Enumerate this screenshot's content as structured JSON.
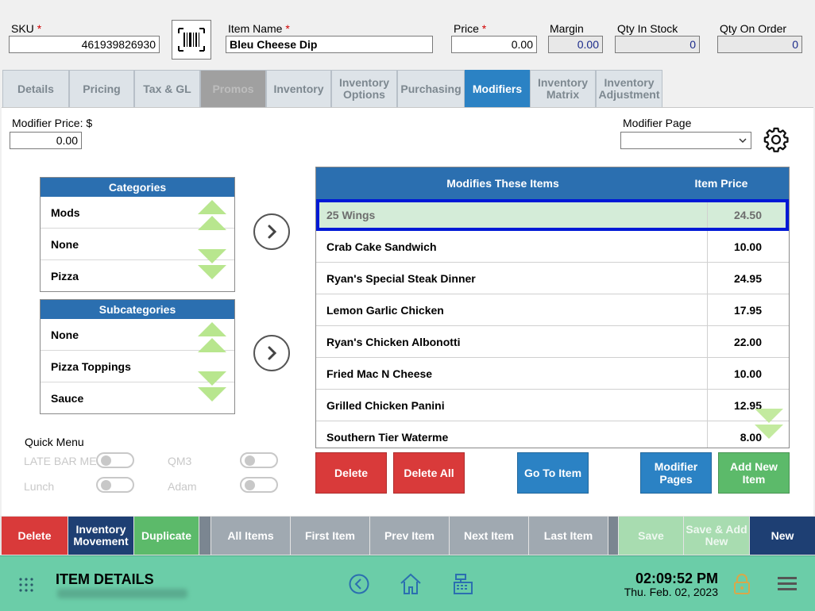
{
  "header": {
    "sku_label": "SKU",
    "sku_value": "461939826930",
    "item_name_label": "Item Name",
    "item_name_value": "Bleu Cheese Dip",
    "price_label": "Price",
    "price_value": "0.00",
    "margin_label": "Margin",
    "margin_value": "0.00",
    "qty_in_stock_label": "Qty In Stock",
    "qty_in_stock_value": "0",
    "qty_on_order_label": "Qty On Order",
    "qty_on_order_value": "0",
    "required_mark": "*"
  },
  "tabs": [
    {
      "label": "Details"
    },
    {
      "label": "Pricing"
    },
    {
      "label": "Tax & GL"
    },
    {
      "label": "Promos"
    },
    {
      "label": "Inventory"
    },
    {
      "label": "Inventory Options"
    },
    {
      "label": "Purchasing"
    },
    {
      "label": "Modifiers"
    },
    {
      "label": "Inventory Matrix"
    },
    {
      "label": "Inventory Adjustment"
    }
  ],
  "modifier": {
    "price_label": "Modifier Price: $",
    "price_value": "0.00",
    "page_label": "Modifier Page",
    "page_value": ""
  },
  "categories": {
    "title": "Categories",
    "items": [
      "Mods",
      "None",
      "Pizza"
    ]
  },
  "subcategories": {
    "title": "Subcategories",
    "items": [
      "None",
      "Pizza Toppings",
      "Sauce"
    ]
  },
  "grid": {
    "col_name": "Modifies These Items",
    "col_price": "Item Price",
    "rows": [
      {
        "name": "25 Wings",
        "price": "24.50"
      },
      {
        "name": "Crab Cake Sandwich",
        "price": "10.00"
      },
      {
        "name": "Ryan's Special Steak Dinner",
        "price": "24.95"
      },
      {
        "name": "Lemon Garlic Chicken",
        "price": "17.95"
      },
      {
        "name": "Ryan's Chicken Albonotti",
        "price": "22.00"
      },
      {
        "name": "Fried Mac N Cheese",
        "price": "10.00"
      },
      {
        "name": "Grilled Chicken Panini",
        "price": "12.95"
      },
      {
        "name": "Southern Tier Waterme",
        "price": "8.00"
      }
    ]
  },
  "actions": {
    "delete": "Delete",
    "delete_all": "Delete All",
    "go_to_item": "Go To Item",
    "modifier_pages": "Modifier Pages",
    "add_new_item": "Add New Item"
  },
  "quick_menu": {
    "title": "Quick Menu",
    "items": [
      "LATE BAR MENU",
      "QM3",
      "Lunch",
      "Adam"
    ]
  },
  "bottom_bar": {
    "delete": "Delete",
    "inventory_movement": "Inventory Movement",
    "duplicate": "Duplicate",
    "all_items": "All Items",
    "first_item": "First Item",
    "prev_item": "Prev Item",
    "next_item": "Next Item",
    "last_item": "Last Item",
    "save": "Save",
    "save_add_new": "Save & Add New",
    "new": "New"
  },
  "footer": {
    "title": "ITEM DETAILS",
    "time": "02:09:52 PM",
    "date": "Thu. Feb. 02, 2023"
  },
  "colors": {
    "accent_blue": "#2b82c4",
    "header_blue": "#2b6fb0",
    "delete_red": "#d93a3a",
    "green": "#5cba6a",
    "footer_teal": "#6bcda8",
    "selection_outline": "#0019d6"
  }
}
